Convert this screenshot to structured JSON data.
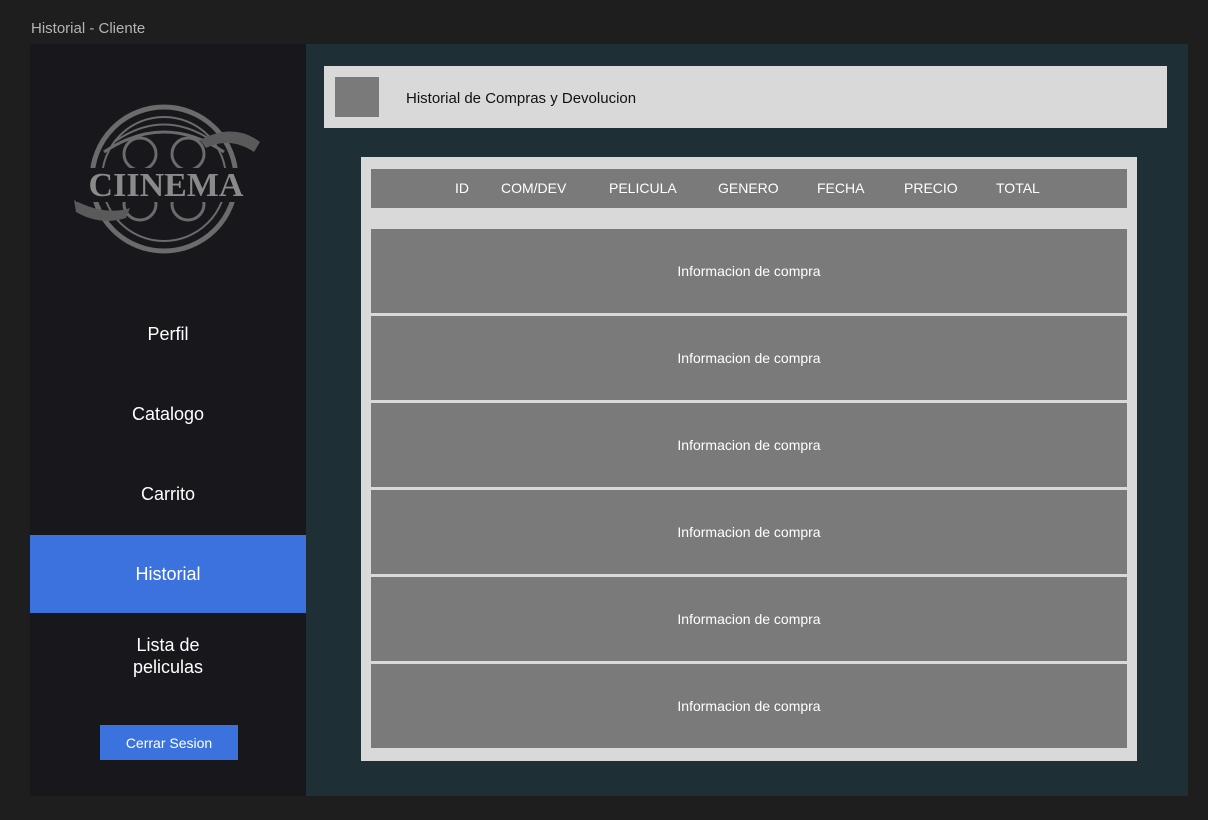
{
  "window": {
    "title": "Historial - Cliente"
  },
  "brand": {
    "logo_text": "CIINEMA"
  },
  "sidebar": {
    "items": [
      {
        "label": "Perfil",
        "active": false
      },
      {
        "label": "Catalogo",
        "active": false
      },
      {
        "label": "Carrito",
        "active": false
      },
      {
        "label": "Historial",
        "active": true
      },
      {
        "label": "Lista de peliculas",
        "active": false
      }
    ],
    "logout_label": "Cerrar Sesion"
  },
  "header": {
    "title": "Historial de Compras y Devolucion"
  },
  "table": {
    "columns": [
      "ID",
      "COM/DEV",
      "PELICULA",
      "GENERO",
      "FECHA",
      "PRECIO",
      "TOTAL"
    ],
    "rows": [
      "Informacion de compra",
      "Informacion de compra",
      "Informacion de compra",
      "Informacion de compra",
      "Informacion de compra",
      "Informacion de compra"
    ]
  },
  "colors": {
    "accent": "#3c72de",
    "sidebar_bg": "#17171c",
    "main_bg": "#1f2f36",
    "panel_bg": "#d9d9d9",
    "row_bg": "#7a7a7a"
  }
}
